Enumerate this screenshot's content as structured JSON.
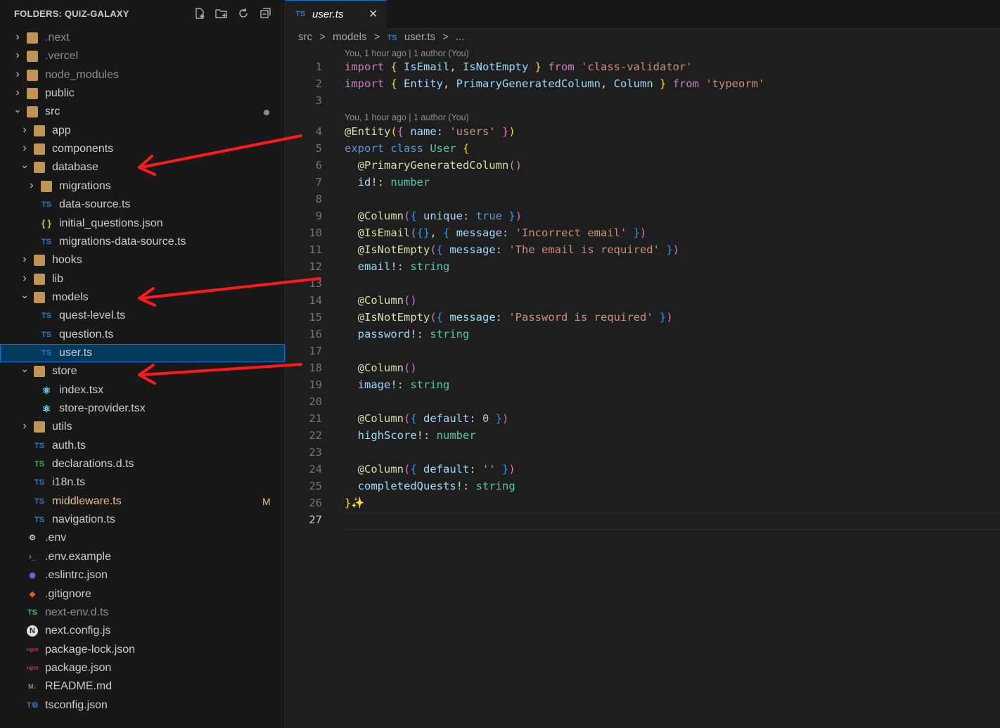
{
  "sidebar": {
    "title": "FOLDERS: QUIZ-GALAXY",
    "actions": [
      "new-file-icon",
      "new-folder-icon",
      "refresh-icon",
      "collapse-all-icon"
    ],
    "items": [
      {
        "label": ".next",
        "type": "folder",
        "expanded": false,
        "level": 0,
        "dim": true
      },
      {
        "label": ".vercel",
        "type": "folder",
        "expanded": false,
        "level": 0,
        "dim": true
      },
      {
        "label": "node_modules",
        "type": "folder",
        "expanded": false,
        "level": 0,
        "dim": true
      },
      {
        "label": "public",
        "type": "folder",
        "expanded": false,
        "level": 0
      },
      {
        "label": "src",
        "type": "folder",
        "expanded": true,
        "level": 0,
        "modified_dot": true
      },
      {
        "label": "app",
        "type": "folder",
        "expanded": false,
        "level": 1
      },
      {
        "label": "components",
        "type": "folder",
        "expanded": false,
        "level": 1
      },
      {
        "label": "database",
        "type": "folder",
        "expanded": true,
        "level": 1
      },
      {
        "label": "migrations",
        "type": "folder",
        "expanded": false,
        "level": 2
      },
      {
        "label": "data-source.ts",
        "type": "ts",
        "level": 2
      },
      {
        "label": "initial_questions.json",
        "type": "json",
        "level": 2
      },
      {
        "label": "migrations-data-source.ts",
        "type": "ts",
        "level": 2
      },
      {
        "label": "hooks",
        "type": "folder",
        "expanded": false,
        "level": 1
      },
      {
        "label": "lib",
        "type": "folder",
        "expanded": false,
        "level": 1
      },
      {
        "label": "models",
        "type": "folder",
        "expanded": true,
        "level": 1
      },
      {
        "label": "quest-level.ts",
        "type": "ts",
        "level": 2
      },
      {
        "label": "question.ts",
        "type": "ts",
        "level": 2
      },
      {
        "label": "user.ts",
        "type": "ts",
        "level": 2,
        "selected": true
      },
      {
        "label": "store",
        "type": "folder",
        "expanded": true,
        "level": 1
      },
      {
        "label": "index.tsx",
        "type": "react",
        "level": 2
      },
      {
        "label": "store-provider.tsx",
        "type": "react",
        "level": 2
      },
      {
        "label": "utils",
        "type": "folder",
        "expanded": false,
        "level": 1
      },
      {
        "label": "auth.ts",
        "type": "ts",
        "level": 1
      },
      {
        "label": "declarations.d.ts",
        "type": "tsd",
        "level": 1
      },
      {
        "label": "i18n.ts",
        "type": "ts",
        "level": 1
      },
      {
        "label": "middleware.ts",
        "type": "ts",
        "level": 1,
        "badge": "M",
        "modified": true
      },
      {
        "label": "navigation.ts",
        "type": "ts",
        "level": 1
      },
      {
        "label": ".env",
        "type": "gear",
        "level": 0
      },
      {
        "label": ".env.example",
        "type": "term",
        "level": 0
      },
      {
        "label": ".eslintrc.json",
        "type": "eslint",
        "level": 0
      },
      {
        "label": ".gitignore",
        "type": "git",
        "level": 0
      },
      {
        "label": "next-env.d.ts",
        "type": "tsd",
        "level": 0,
        "dim": true
      },
      {
        "label": "next.config.js",
        "type": "next",
        "level": 0
      },
      {
        "label": "package-lock.json",
        "type": "npm",
        "level": 0
      },
      {
        "label": "package.json",
        "type": "npm",
        "level": 0
      },
      {
        "label": "README.md",
        "type": "md",
        "level": 0
      },
      {
        "label": "tsconfig.json",
        "type": "tsconfig",
        "level": 0
      }
    ]
  },
  "tab": {
    "icon": "TS",
    "name": "user.ts",
    "close": "✕"
  },
  "breadcrumb": [
    "src",
    ">",
    "models",
    ">",
    "TS",
    "user.ts",
    ">",
    "..."
  ],
  "blame": {
    "first": "You, 1 hour ago | 1 author (You)",
    "second": "You, 1 hour ago | 1 author (You)"
  },
  "code": {
    "active_line": 27,
    "lines": [
      [
        [
          "kc",
          "import "
        ],
        [
          "br1",
          "{ "
        ],
        [
          "prop",
          "IsEmail"
        ],
        [
          "plain",
          ", "
        ],
        [
          "prop",
          "IsNotEmpty"
        ],
        [
          "br1",
          " }"
        ],
        [
          "kc",
          " from "
        ],
        [
          "st",
          "'class-validator'"
        ]
      ],
      [
        [
          "kc",
          "import "
        ],
        [
          "br1",
          "{ "
        ],
        [
          "prop",
          "Entity"
        ],
        [
          "plain",
          ", "
        ],
        [
          "prop",
          "PrimaryGeneratedColumn"
        ],
        [
          "plain",
          ", "
        ],
        [
          "prop",
          "Column"
        ],
        [
          "br1",
          " }"
        ],
        [
          "kc",
          " from "
        ],
        [
          "st",
          "'typeorm'"
        ]
      ],
      [],
      [
        [
          "fn",
          "@Entity"
        ],
        [
          "br1",
          "("
        ],
        [
          "br2",
          "{ "
        ],
        [
          "prop",
          "name"
        ],
        [
          "plain",
          ": "
        ],
        [
          "st",
          "'users'"
        ],
        [
          "br2",
          " }"
        ],
        [
          "br1",
          ")"
        ]
      ],
      [
        [
          "kw",
          "export "
        ],
        [
          "kw",
          "class "
        ],
        [
          "cls",
          "User "
        ],
        [
          "br1",
          "{"
        ]
      ],
      [
        [
          "plain",
          "  "
        ],
        [
          "fn",
          "@PrimaryGeneratedColumn"
        ],
        [
          "br2",
          "()"
        ]
      ],
      [
        [
          "plain",
          "  "
        ],
        [
          "prop",
          "id"
        ],
        [
          "plain",
          "!: "
        ],
        [
          "cls",
          "number"
        ]
      ],
      [],
      [
        [
          "plain",
          "  "
        ],
        [
          "fn",
          "@Column"
        ],
        [
          "br2",
          "("
        ],
        [
          "br3",
          "{ "
        ],
        [
          "prop",
          "unique"
        ],
        [
          "plain",
          ": "
        ],
        [
          "kw",
          "true"
        ],
        [
          "br3",
          " }"
        ],
        [
          "br2",
          ")"
        ]
      ],
      [
        [
          "plain",
          "  "
        ],
        [
          "fn",
          "@IsEmail"
        ],
        [
          "br2",
          "("
        ],
        [
          "br3",
          "{}"
        ],
        [
          "plain",
          ", "
        ],
        [
          "br3",
          "{ "
        ],
        [
          "prop",
          "message"
        ],
        [
          "plain",
          ": "
        ],
        [
          "st",
          "'Incorrect email'"
        ],
        [
          "br3",
          " }"
        ],
        [
          "br2",
          ")"
        ]
      ],
      [
        [
          "plain",
          "  "
        ],
        [
          "fn",
          "@IsNotEmpty"
        ],
        [
          "br2",
          "("
        ],
        [
          "br3",
          "{ "
        ],
        [
          "prop",
          "message"
        ],
        [
          "plain",
          ": "
        ],
        [
          "st",
          "'The email is required'"
        ],
        [
          "br3",
          " }"
        ],
        [
          "br2",
          ")"
        ]
      ],
      [
        [
          "plain",
          "  "
        ],
        [
          "prop",
          "email"
        ],
        [
          "plain",
          "!: "
        ],
        [
          "cls",
          "string"
        ]
      ],
      [],
      [
        [
          "plain",
          "  "
        ],
        [
          "fn",
          "@Column"
        ],
        [
          "br2",
          "()"
        ]
      ],
      [
        [
          "plain",
          "  "
        ],
        [
          "fn",
          "@IsNotEmpty"
        ],
        [
          "br2",
          "("
        ],
        [
          "br3",
          "{ "
        ],
        [
          "prop",
          "message"
        ],
        [
          "plain",
          ": "
        ],
        [
          "st",
          "'Password is required'"
        ],
        [
          "br3",
          " }"
        ],
        [
          "br2",
          ")"
        ]
      ],
      [
        [
          "plain",
          "  "
        ],
        [
          "prop",
          "password"
        ],
        [
          "plain",
          "!: "
        ],
        [
          "cls",
          "string"
        ]
      ],
      [],
      [
        [
          "plain",
          "  "
        ],
        [
          "fn",
          "@Column"
        ],
        [
          "br2",
          "()"
        ]
      ],
      [
        [
          "plain",
          "  "
        ],
        [
          "prop",
          "image"
        ],
        [
          "plain",
          "!: "
        ],
        [
          "cls",
          "string"
        ]
      ],
      [],
      [
        [
          "plain",
          "  "
        ],
        [
          "fn",
          "@Column"
        ],
        [
          "br2",
          "("
        ],
        [
          "br3",
          "{ "
        ],
        [
          "prop",
          "default"
        ],
        [
          "plain",
          ": "
        ],
        [
          "num",
          "0"
        ],
        [
          "br3",
          " }"
        ],
        [
          "br2",
          ")"
        ]
      ],
      [
        [
          "plain",
          "  "
        ],
        [
          "prop",
          "highScore"
        ],
        [
          "plain",
          "!: "
        ],
        [
          "cls",
          "number"
        ]
      ],
      [],
      [
        [
          "plain",
          "  "
        ],
        [
          "fn",
          "@Column"
        ],
        [
          "br2",
          "("
        ],
        [
          "br3",
          "{ "
        ],
        [
          "prop",
          "default"
        ],
        [
          "plain",
          ": "
        ],
        [
          "st",
          "''"
        ],
        [
          "br3",
          " }"
        ],
        [
          "br2",
          ")"
        ]
      ],
      [
        [
          "plain",
          "  "
        ],
        [
          "prop",
          "completedQuests"
        ],
        [
          "plain",
          "!: "
        ],
        [
          "cls",
          "string"
        ]
      ],
      [
        [
          "br1",
          "}"
        ],
        [
          "fn",
          "✨"
        ]
      ],
      []
    ]
  },
  "colors": {
    "arrow": "#ff1a1a",
    "selection": "#04395e",
    "accent": "#0078d4"
  }
}
